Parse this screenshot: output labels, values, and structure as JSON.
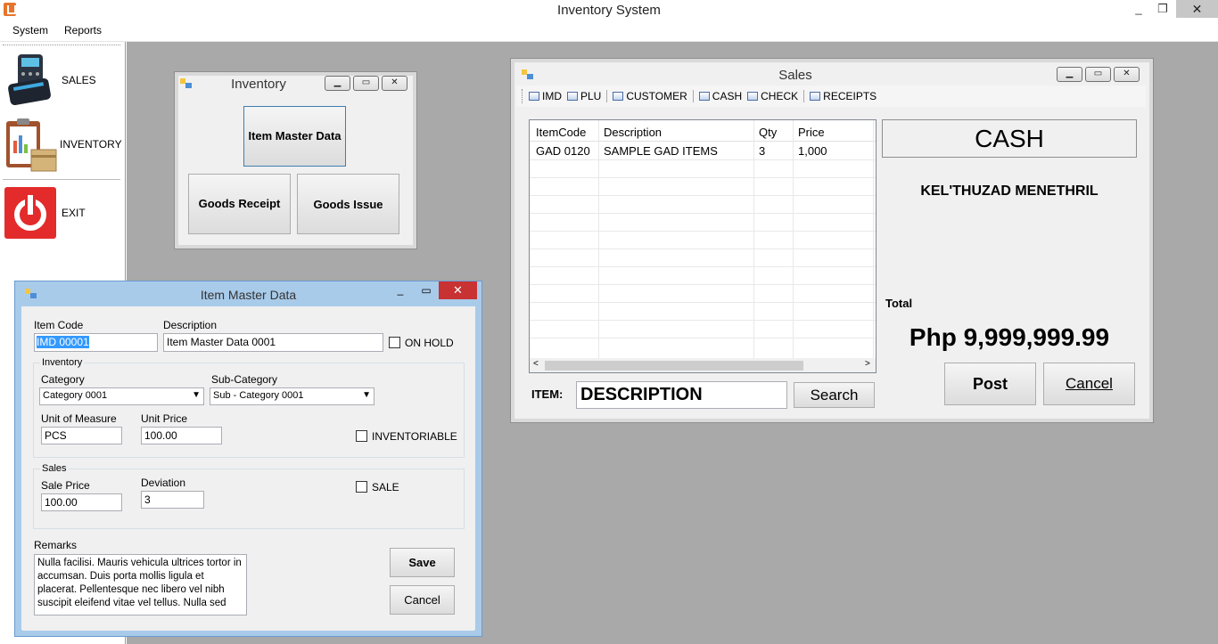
{
  "app": {
    "title": "Inventory System",
    "window_controls": {
      "minimize": "_",
      "restore": "❐",
      "close": "✕"
    }
  },
  "menu": {
    "system": "System",
    "reports": "Reports"
  },
  "sidebar": {
    "sales": "SALES",
    "inventory": "INVENTORY",
    "exit": "EXIT"
  },
  "inventory_window": {
    "title": "Inventory",
    "item_master": "Item Master Data",
    "goods_receipt": "Goods Receipt",
    "goods_issue": "Goods Issue"
  },
  "sales_window": {
    "title": "Sales",
    "toolbar": [
      "IMD",
      "PLU",
      "CUSTOMER",
      "CASH",
      "CHECK",
      "RECEIPTS"
    ],
    "grid": {
      "columns": [
        "ItemCode",
        "Description",
        "Qty",
        "Price"
      ],
      "rows": [
        [
          "GAD 0120",
          "SAMPLE GAD ITEMS",
          "3",
          "1,000"
        ]
      ]
    },
    "payment_type": "CASH",
    "customer": "KEL'THUZAD MENETHRIL",
    "total_label": "Total",
    "total_value": "Php 9,999,999.99",
    "post": "Post",
    "cancel": "Cancel",
    "item_label": "ITEM:",
    "item_value": "DESCRIPTION",
    "search": "Search"
  },
  "item_master_window": {
    "title": "Item Master Data",
    "item_code_label": "Item Code",
    "item_code": "IMD 00001",
    "description_label": "Description",
    "description": "Item Master Data 0001",
    "on_hold": "ON HOLD",
    "inventory_group": "Inventory",
    "category_label": "Category",
    "category": "Category 0001",
    "subcategory_label": "Sub-Category",
    "subcategory": "Sub - Category 0001",
    "uom_label": "Unit of Measure",
    "uom": "PCS",
    "unit_price_label": "Unit Price",
    "unit_price": "100.00",
    "inventoriable": "INVENTORIABLE",
    "sales_group": "Sales",
    "sale_price_label": "Sale Price",
    "sale_price": "100.00",
    "deviation_label": "Deviation",
    "deviation": "3",
    "sale": "SALE",
    "remarks_label": "Remarks",
    "remarks": "Nulla facilisi. Mauris vehicula ultrices tortor in accumsan. Duis porta mollis ligula et placerat. Pellentesque nec libero vel nibh suscipit eleifend vitae vel tellus. Nulla sed",
    "save": "Save",
    "cancel": "Cancel"
  }
}
